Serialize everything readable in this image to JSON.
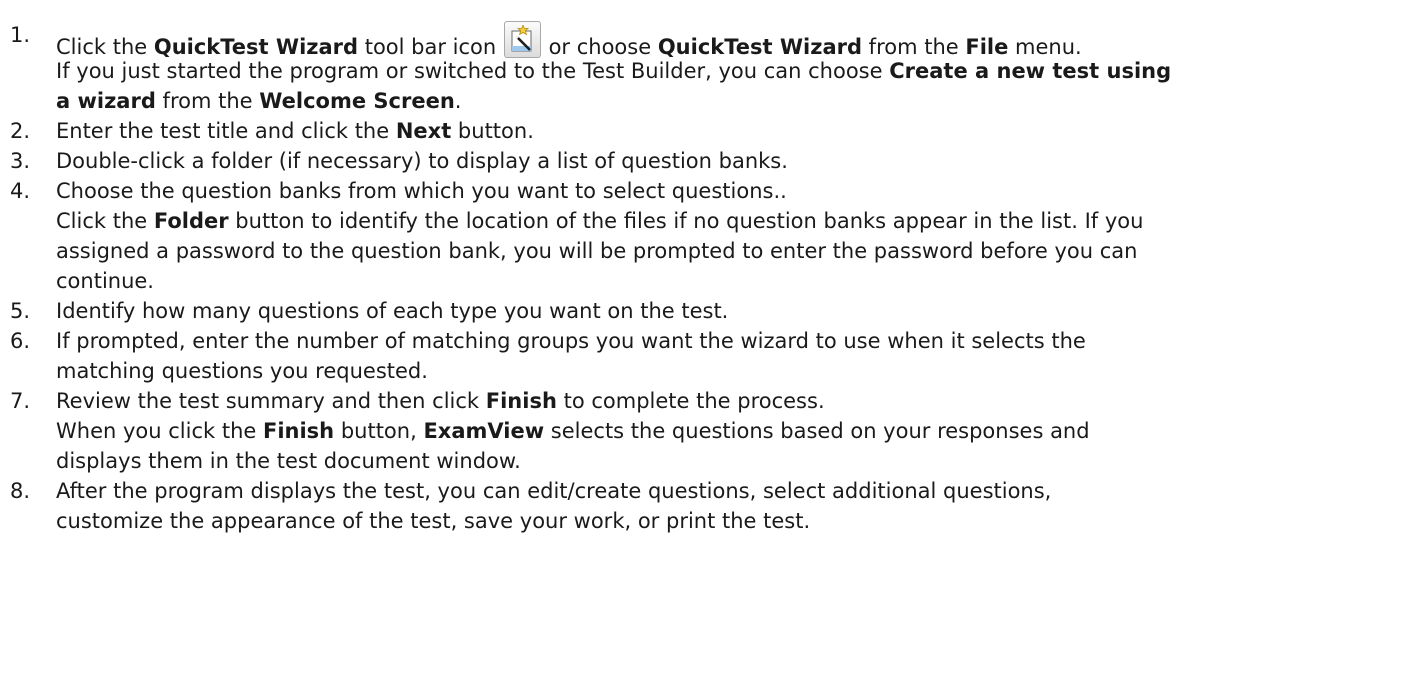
{
  "steps": [
    {
      "number": "1.",
      "lines": [
        {
          "pre": "Click the ",
          "b1": "QuickTest Wizard",
          "mid": " tool bar icon ",
          "post": " or choose ",
          "b2": "QuickTest Wizard",
          "mid2": " from the ",
          "b3": "File",
          "end": " menu."
        },
        {
          "pre": "If you just started the program or switched to the Test Builder, you can choose ",
          "b1": "Create a new test using"
        },
        {
          "b1": "a wizard",
          "mid": " from the ",
          "b2": "Welcome Screen",
          "end": "."
        }
      ]
    },
    {
      "number": "2.",
      "lines": [
        {
          "pre": "Enter the test title and click the ",
          "b1": "Next",
          "end": " button."
        }
      ]
    },
    {
      "number": "3.",
      "lines": [
        {
          "text": "Double-click a folder (if necessary) to display a list of question banks."
        }
      ]
    },
    {
      "number": "4.",
      "lines": [
        {
          "text": "Choose the question banks from which you want to select questions.."
        },
        {
          "pre": "Click the ",
          "b1": "Folder",
          "end": " button to identify the location of the files if no question banks appear in the list. If you"
        },
        {
          "text": "assigned a password to the question bank, you will be prompted to enter the password before you can"
        },
        {
          "text": "continue."
        }
      ]
    },
    {
      "number": "5.",
      "lines": [
        {
          "text": "Identify how many questions of each type you want on the test."
        }
      ]
    },
    {
      "number": "6.",
      "lines": [
        {
          "text": "If prompted, enter the number of matching groups you want the wizard to use when it selects the"
        },
        {
          "text": "matching questions you requested."
        }
      ]
    },
    {
      "number": "7.",
      "lines": [
        {
          "pre": "Review the test summary and then click ",
          "b1": "Finish",
          "end": " to complete the process."
        },
        {
          "pre": "When you click the ",
          "b1": "Finish",
          "mid": " button, ",
          "b2": "ExamView",
          "end": " selects the questions based on your responses and"
        },
        {
          "text": "displays them in the test document window."
        }
      ]
    },
    {
      "number": "8.",
      "lines": [
        {
          "text": "After the program displays the test, you can edit/create questions, select additional questions,"
        },
        {
          "text": "customize the appearance of the test, save your work, or print the test."
        }
      ]
    }
  ],
  "icons": {
    "wizard": "quicktest-wizard-icon"
  }
}
